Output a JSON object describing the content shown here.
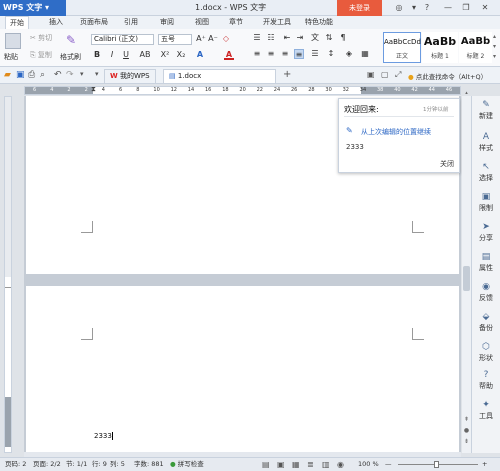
{
  "app": {
    "name": "WPS 文字",
    "doc_title": "1.docx - WPS 文字",
    "login": "未登录"
  },
  "window": {
    "minimize": "—",
    "restore": "❐",
    "close": "✕",
    "extra1": "◎",
    "extra2": "▾",
    "extra3": "?"
  },
  "tabs": [
    "开始",
    "插入",
    "页面布局",
    "引用",
    "审阅",
    "视图",
    "章节",
    "开发工具",
    "特色功能"
  ],
  "ribbon": {
    "paste": "粘贴",
    "cut": "剪切",
    "copy": "复制",
    "format_painter": "格式刷",
    "font_name": "Calibri (正文)",
    "font_size": "五号",
    "grow": "A⁺",
    "shrink": "A⁻",
    "clear": "◇",
    "bold": "B",
    "italic": "I",
    "underline": "U",
    "abc": "AB",
    "super": "X²",
    "sub": "X₂",
    "font_color": "A",
    "styles": [
      {
        "sample": "AaBbCcDd",
        "name": "正文"
      },
      {
        "sample": "AaBb",
        "name": "标题 1"
      },
      {
        "sample": "AaBb",
        "name": "标题 2"
      }
    ]
  },
  "docbar": {
    "tab1": "我的WPS",
    "tab2": "1.docx",
    "new_tab": "+",
    "search_hint": "点此查找命令（Alt+Q）"
  },
  "ruler": {
    "numbers": [
      "6",
      "4",
      "2",
      "2",
      "4",
      "6",
      "8",
      "10",
      "12",
      "14",
      "16",
      "18",
      "20",
      "22",
      "24",
      "26",
      "28",
      "30",
      "32",
      "34",
      "38",
      "40",
      "42",
      "44",
      "46"
    ]
  },
  "welcome": {
    "title": "欢迎回来:",
    "time": "1分钟以前",
    "link": "从上次编辑的位置继续",
    "value": "2333",
    "close": "关闭"
  },
  "sidebar": [
    {
      "icon": "new-icon",
      "glyph": "✎",
      "label": "新建"
    },
    {
      "icon": "style-icon",
      "glyph": "A",
      "label": "样式"
    },
    {
      "icon": "select-icon",
      "glyph": "↖",
      "label": "选择"
    },
    {
      "icon": "limit-icon",
      "glyph": "▣",
      "label": "限制"
    },
    {
      "icon": "share-icon",
      "glyph": "➤",
      "label": "分享"
    },
    {
      "icon": "property-icon",
      "glyph": "▤",
      "label": "属性"
    },
    {
      "icon": "feedback-icon",
      "glyph": "◉",
      "label": "反馈"
    },
    {
      "icon": "backup-icon",
      "glyph": "⬙",
      "label": "备份"
    },
    {
      "icon": "shape-icon",
      "glyph": "⬡",
      "label": "形状"
    },
    {
      "icon": "help-icon",
      "glyph": "?",
      "label": "帮助"
    },
    {
      "icon": "tools-icon",
      "glyph": "✦",
      "label": "工具"
    }
  ],
  "page_text": "2333",
  "status": {
    "page": "页码: 2",
    "pages": "页面: 2/2",
    "section": "节: 1/1",
    "row": "行: 9",
    "col": "列: 5",
    "words": "字数: 881",
    "spell": "拼写检查",
    "zoom": "100 %",
    "zoom_minus": "—",
    "zoom_plus": "+"
  }
}
